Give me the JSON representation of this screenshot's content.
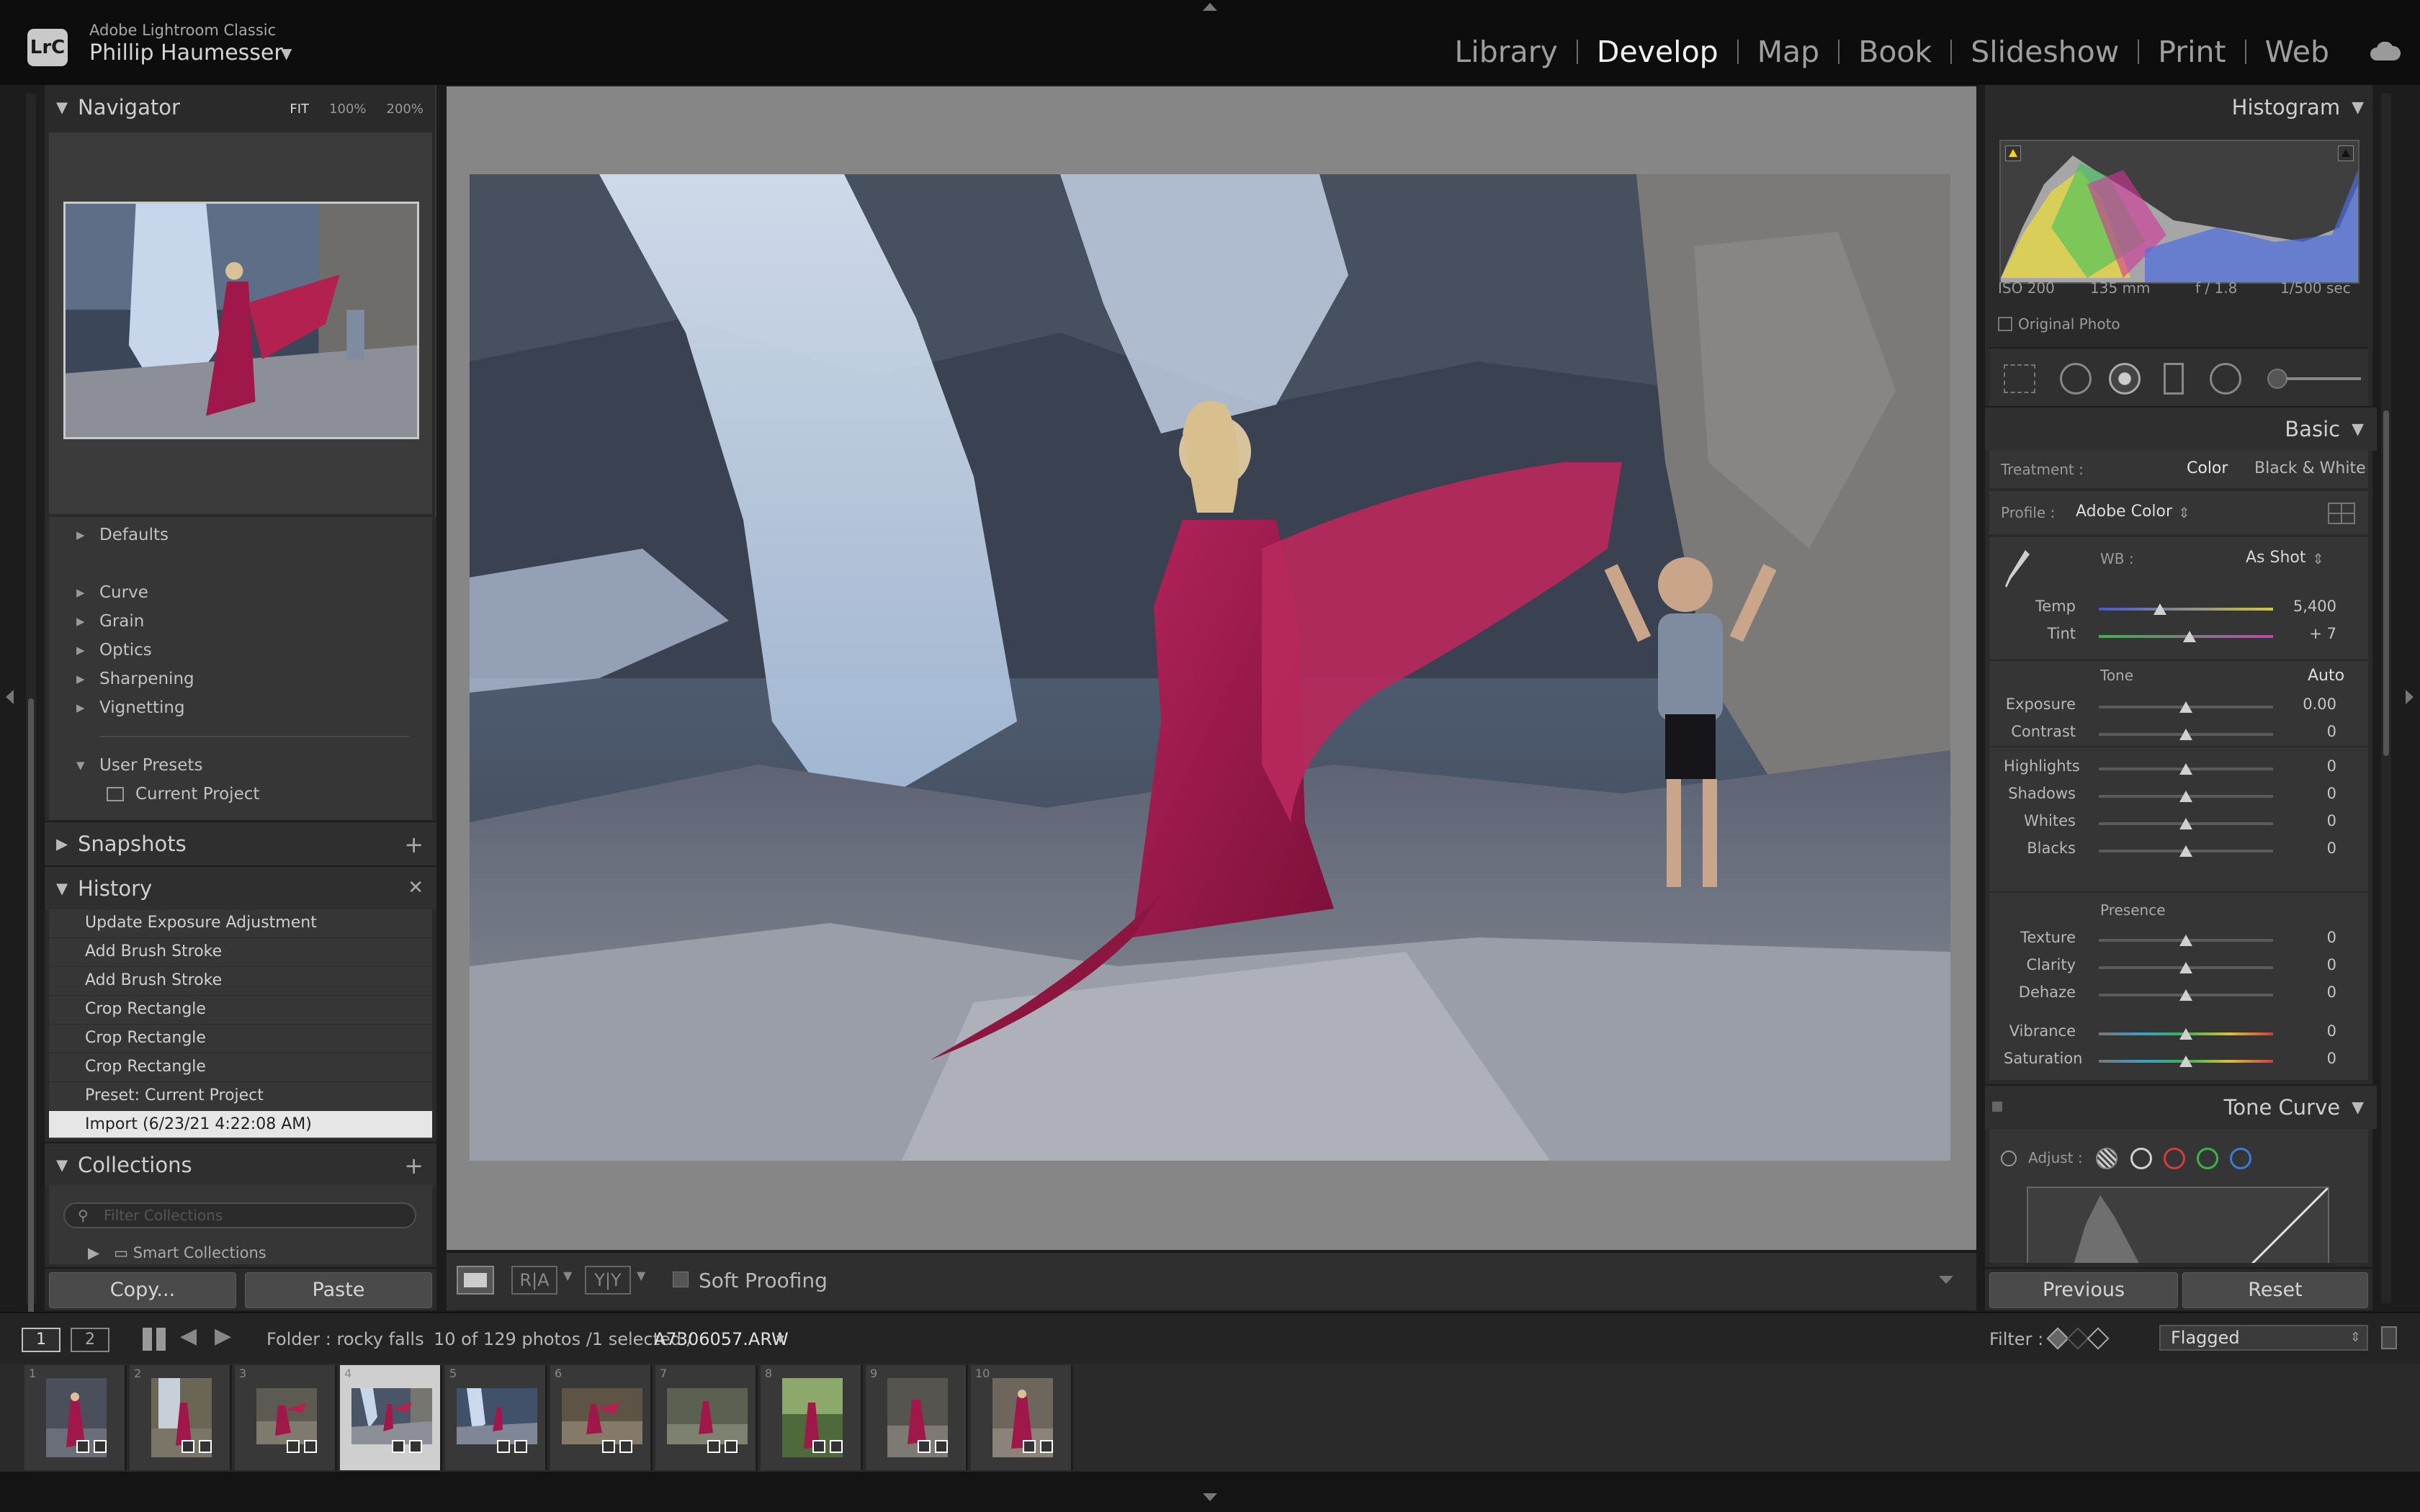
{
  "app": {
    "name": "Adobe Lightroom Classic",
    "logo": "LrC",
    "user": "Phillip Haumesser"
  },
  "modules": [
    "Library",
    "Develop",
    "Map",
    "Book",
    "Slideshow",
    "Print",
    "Web"
  ],
  "active_module": "Develop",
  "navigator": {
    "title": "Navigator",
    "zoom_options": [
      "FIT",
      "100%",
      "200%"
    ]
  },
  "presets": {
    "items": [
      "Defaults",
      "Curve",
      "Grain",
      "Optics",
      "Sharpening",
      "Vignetting"
    ],
    "user_presets": "User Presets",
    "current_project": "Current Project"
  },
  "snapshots": {
    "title": "Snapshots"
  },
  "history": {
    "title": "History",
    "items": [
      "Update Exposure Adjustment",
      "Add Brush Stroke",
      "Add Brush Stroke",
      "Crop Rectangle",
      "Crop Rectangle",
      "Crop Rectangle",
      "Preset: Current Project",
      "Import (6/23/21 4:22:08 AM)"
    ],
    "selected_index": 7
  },
  "collections": {
    "title": "Collections",
    "filter_placeholder": "Filter Collections",
    "items": [
      "Smart Collections"
    ]
  },
  "left_buttons": {
    "copy": "Copy...",
    "paste": "Paste"
  },
  "toolbar": {
    "soft_proofing": "Soft Proofing",
    "compare_ra": "R|A",
    "compare_yy": "Y|Y"
  },
  "histogram": {
    "title": "Histogram",
    "iso": "ISO 200",
    "focal": "135 mm",
    "aperture": "f / 1.8",
    "shutter": "1/500 sec",
    "original_photo": "Original Photo"
  },
  "basic": {
    "title": "Basic",
    "treatment_label": "Treatment :",
    "treatment_color": "Color",
    "treatment_bw": "Black & White",
    "profile_label": "Profile :",
    "profile_value": "Adobe Color",
    "wb_label": "WB :",
    "wb_value": "As Shot",
    "temp_label": "Temp",
    "temp_value": "5,400",
    "temp_level": 0.35,
    "tint_label": "Tint",
    "tint_value": "+ 7",
    "tint_level": 0.52,
    "tone_label": "Tone",
    "auto_label": "Auto",
    "exposure_label": "Exposure",
    "exposure_value": "0.00",
    "contrast_label": "Contrast",
    "contrast_value": "0",
    "highlights_label": "Highlights",
    "highlights_value": "0",
    "shadows_label": "Shadows",
    "shadows_value": "0",
    "whites_label": "Whites",
    "whites_value": "0",
    "blacks_label": "Blacks",
    "blacks_value": "0",
    "presence_label": "Presence",
    "texture_label": "Texture",
    "texture_value": "0",
    "clarity_label": "Clarity",
    "clarity_value": "0",
    "dehaze_label": "Dehaze",
    "dehaze_value": "0",
    "vibrance_label": "Vibrance",
    "vibrance_value": "0",
    "saturation_label": "Saturation",
    "saturation_value": "0"
  },
  "tone_curve": {
    "title": "Tone Curve",
    "adjust_label": "Adjust :"
  },
  "right_buttons": {
    "previous": "Previous",
    "reset": "Reset"
  },
  "filmstrip_bar": {
    "page1": "1",
    "page2": "2",
    "folder": "Folder : rocky falls",
    "count": "10 of 129 photos /1 selected /",
    "filename": "A7306057.ARW",
    "filter_label": "Filter :",
    "filter_value": "Flagged"
  },
  "filmstrip": {
    "numbers": [
      "1",
      "2",
      "3",
      "4",
      "5",
      "6",
      "7",
      "8",
      "9",
      "10"
    ],
    "selected_index": 3
  },
  "colors": {
    "magenta_dress": "#a0184a",
    "panel": "#2a2a2a",
    "accent_selected": "#e6e6e6"
  }
}
